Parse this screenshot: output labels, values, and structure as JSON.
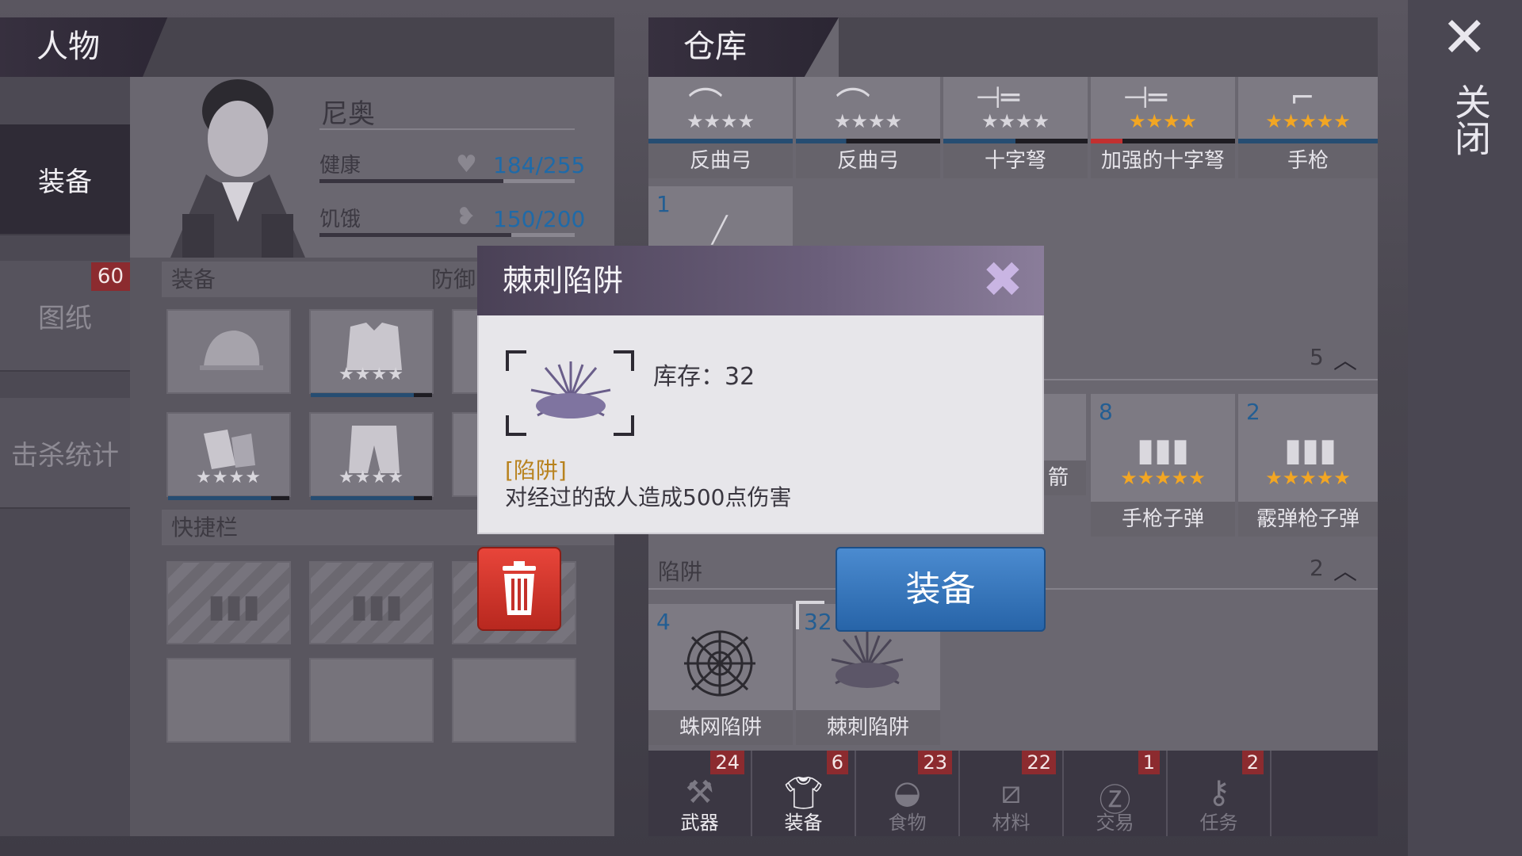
{
  "left_panel": {
    "tab_title": "人物",
    "side_nav": [
      {
        "label": "装备",
        "active": true
      },
      {
        "label": "图纸",
        "badge": "60"
      },
      {
        "label": "击杀统计"
      }
    ],
    "character": {
      "name": "尼奥",
      "stats": [
        {
          "label": "健康",
          "icon": "heart-icon",
          "value": "184/255",
          "ratio": 0.72
        },
        {
          "label": "饥饿",
          "icon": "stomach-icon",
          "value": "150/200",
          "ratio": 0.75
        }
      ]
    },
    "equipment": {
      "title": "装备",
      "defense_label": "防御",
      "slots": [
        {
          "item": "helmet",
          "stars": ""
        },
        {
          "item": "vest",
          "stars": "★★★★"
        },
        {
          "item": "gloves",
          "stars": "★★★★"
        },
        {
          "item": "pants",
          "stars": "★★★★"
        }
      ]
    },
    "quickbar": {
      "title": "快捷栏"
    }
  },
  "warehouse": {
    "tab_title": "仓库",
    "weapons": [
      {
        "name": "反曲弓",
        "stars": "★★★★",
        "gold": false
      },
      {
        "name": "反曲弓",
        "stars": "★★★★",
        "gold": false
      },
      {
        "name": "十字弩",
        "stars": "★★★★",
        "gold": false
      },
      {
        "name": "加强的十字弩",
        "stars": "★★★★",
        "gold": true
      },
      {
        "name": "手枪",
        "stars": "★★★★★",
        "gold": true
      }
    ],
    "extra_count": "1",
    "ammo_section_count": "5",
    "ammo": [
      {
        "count": "8",
        "name": "手枪子弹",
        "stars": "★★★★★"
      },
      {
        "count": "2",
        "name": "霰弹枪子弹",
        "stars": "★★★★★"
      }
    ],
    "partial_label": "箭",
    "traps_section": {
      "title": "陷阱",
      "count": "2"
    },
    "traps": [
      {
        "count": "4",
        "name": "蛛网陷阱"
      },
      {
        "count": "32",
        "name": "棘刺陷阱"
      }
    ],
    "bottom_tabs": [
      {
        "label": "武器",
        "count": "24",
        "icon": "axe-icon"
      },
      {
        "label": "装备",
        "count": "6",
        "icon": "shirt-icon",
        "active": true
      },
      {
        "label": "食物",
        "count": "23",
        "icon": "meat-icon"
      },
      {
        "label": "材料",
        "count": "22",
        "icon": "wood-icon"
      },
      {
        "label": "交易",
        "count": "1",
        "icon": "coin-icon"
      },
      {
        "label": "任务",
        "count": "2",
        "icon": "key-icon"
      }
    ]
  },
  "close": {
    "label": "关闭"
  },
  "modal": {
    "title": "棘刺陷阱",
    "stock_label": "库存：",
    "stock_value": "32",
    "tag": "[陷阱]",
    "description": "对经过的敌人造成500点伤害",
    "equip_button": "装备"
  }
}
